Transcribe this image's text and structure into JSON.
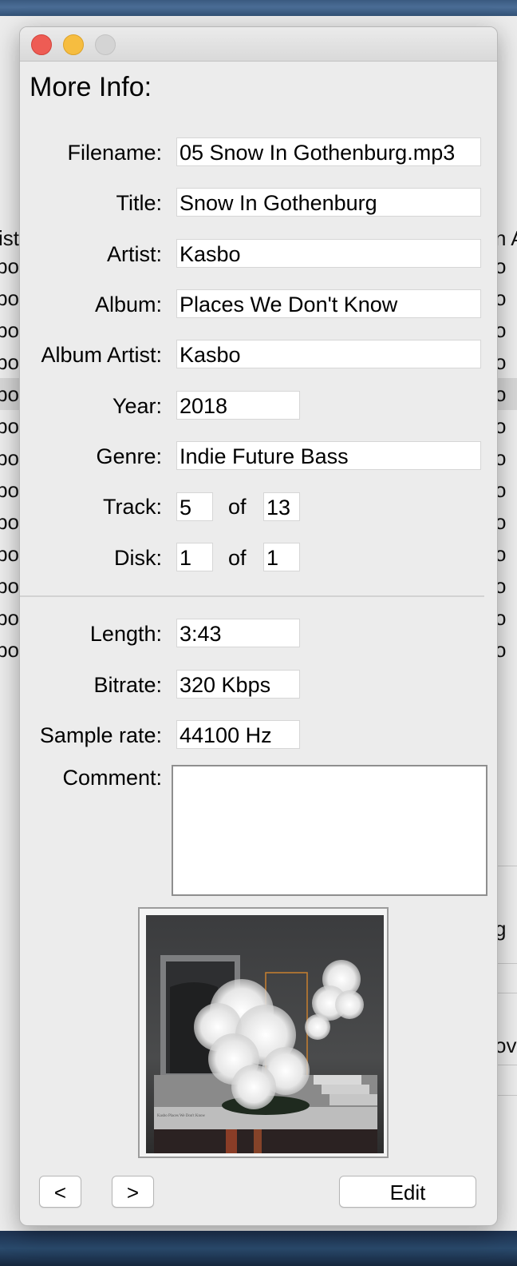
{
  "dialog": {
    "heading": "More Info:",
    "fields": {
      "filename": {
        "label": "Filename:",
        "value": "05 Snow In Gothenburg.mp3"
      },
      "title": {
        "label": "Title:",
        "value": "Snow In Gothenburg"
      },
      "artist": {
        "label": "Artist:",
        "value": "Kasbo"
      },
      "album": {
        "label": "Album:",
        "value": "Places We Don't Know"
      },
      "album_artist": {
        "label": "Album Artist:",
        "value": "Kasbo"
      },
      "year": {
        "label": "Year:",
        "value": "2018"
      },
      "genre": {
        "label": "Genre:",
        "value": "Indie Future Bass"
      },
      "track": {
        "label": "Track:",
        "value": "5",
        "of_label": "of",
        "total": "13"
      },
      "disk": {
        "label": "Disk:",
        "value": "1",
        "of_label": "of",
        "total": "1"
      },
      "length": {
        "label": "Length:",
        "value": "3:43"
      },
      "bitrate": {
        "label": "Bitrate:",
        "value": "320 Kbps"
      },
      "sample_rate": {
        "label": "Sample rate:",
        "value": "44100 Hz"
      },
      "comment": {
        "label": "Comment:",
        "value": ""
      }
    },
    "album_art": {
      "caption": "Kasbo  Places We Don't Know"
    },
    "buttons": {
      "prev": "<",
      "next": ">",
      "edit": "Edit"
    }
  },
  "background_window": {
    "left_header": "tist",
    "left_rows": [
      "sbo",
      "sbo",
      "sbo",
      "sbo",
      "sbo",
      "sbo",
      "sbo",
      "sbo",
      "sbo",
      "sbo",
      "sbo",
      "sbo",
      "sbo"
    ],
    "right_header": "n A",
    "right_rows": [
      "o",
      "o",
      "o",
      "o",
      "o",
      "o",
      "o",
      "o",
      "o",
      "o",
      "o",
      "o",
      "o"
    ],
    "right_lower": [
      "g",
      "ov"
    ]
  },
  "colors": {
    "close": "#ee5c54",
    "minimize": "#f6bd40",
    "maximize": "#d4d4d4",
    "dialog_bg": "#ececec"
  }
}
